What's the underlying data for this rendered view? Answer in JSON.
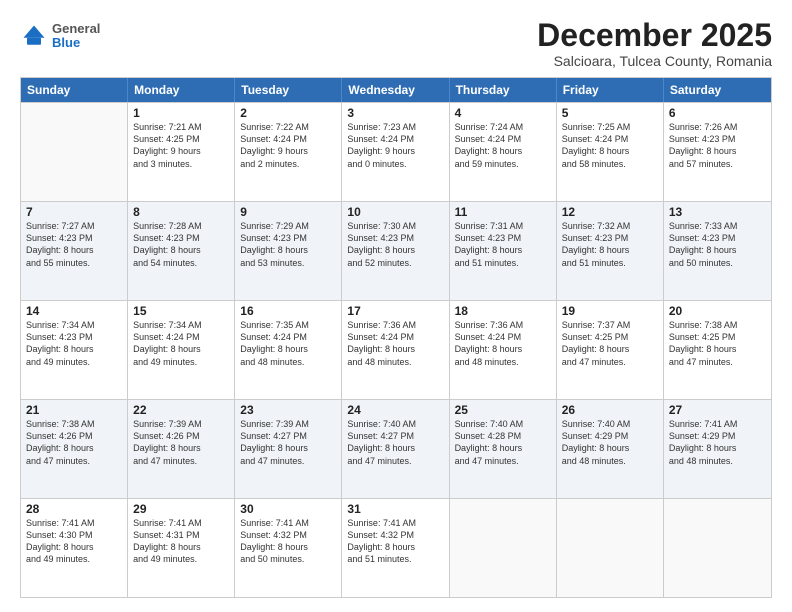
{
  "header": {
    "logo": {
      "general": "General",
      "blue": "Blue"
    },
    "title": "December 2025",
    "subtitle": "Salcioara, Tulcea County, Romania"
  },
  "calendar": {
    "days_of_week": [
      "Sunday",
      "Monday",
      "Tuesday",
      "Wednesday",
      "Thursday",
      "Friday",
      "Saturday"
    ],
    "rows": [
      [
        {
          "day": "",
          "info": ""
        },
        {
          "day": "1",
          "info": "Sunrise: 7:21 AM\nSunset: 4:25 PM\nDaylight: 9 hours\nand 3 minutes."
        },
        {
          "day": "2",
          "info": "Sunrise: 7:22 AM\nSunset: 4:24 PM\nDaylight: 9 hours\nand 2 minutes."
        },
        {
          "day": "3",
          "info": "Sunrise: 7:23 AM\nSunset: 4:24 PM\nDaylight: 9 hours\nand 0 minutes."
        },
        {
          "day": "4",
          "info": "Sunrise: 7:24 AM\nSunset: 4:24 PM\nDaylight: 8 hours\nand 59 minutes."
        },
        {
          "day": "5",
          "info": "Sunrise: 7:25 AM\nSunset: 4:24 PM\nDaylight: 8 hours\nand 58 minutes."
        },
        {
          "day": "6",
          "info": "Sunrise: 7:26 AM\nSunset: 4:23 PM\nDaylight: 8 hours\nand 57 minutes."
        }
      ],
      [
        {
          "day": "7",
          "info": "Sunrise: 7:27 AM\nSunset: 4:23 PM\nDaylight: 8 hours\nand 55 minutes."
        },
        {
          "day": "8",
          "info": "Sunrise: 7:28 AM\nSunset: 4:23 PM\nDaylight: 8 hours\nand 54 minutes."
        },
        {
          "day": "9",
          "info": "Sunrise: 7:29 AM\nSunset: 4:23 PM\nDaylight: 8 hours\nand 53 minutes."
        },
        {
          "day": "10",
          "info": "Sunrise: 7:30 AM\nSunset: 4:23 PM\nDaylight: 8 hours\nand 52 minutes."
        },
        {
          "day": "11",
          "info": "Sunrise: 7:31 AM\nSunset: 4:23 PM\nDaylight: 8 hours\nand 51 minutes."
        },
        {
          "day": "12",
          "info": "Sunrise: 7:32 AM\nSunset: 4:23 PM\nDaylight: 8 hours\nand 51 minutes."
        },
        {
          "day": "13",
          "info": "Sunrise: 7:33 AM\nSunset: 4:23 PM\nDaylight: 8 hours\nand 50 minutes."
        }
      ],
      [
        {
          "day": "14",
          "info": "Sunrise: 7:34 AM\nSunset: 4:23 PM\nDaylight: 8 hours\nand 49 minutes."
        },
        {
          "day": "15",
          "info": "Sunrise: 7:34 AM\nSunset: 4:24 PM\nDaylight: 8 hours\nand 49 minutes."
        },
        {
          "day": "16",
          "info": "Sunrise: 7:35 AM\nSunset: 4:24 PM\nDaylight: 8 hours\nand 48 minutes."
        },
        {
          "day": "17",
          "info": "Sunrise: 7:36 AM\nSunset: 4:24 PM\nDaylight: 8 hours\nand 48 minutes."
        },
        {
          "day": "18",
          "info": "Sunrise: 7:36 AM\nSunset: 4:24 PM\nDaylight: 8 hours\nand 48 minutes."
        },
        {
          "day": "19",
          "info": "Sunrise: 7:37 AM\nSunset: 4:25 PM\nDaylight: 8 hours\nand 47 minutes."
        },
        {
          "day": "20",
          "info": "Sunrise: 7:38 AM\nSunset: 4:25 PM\nDaylight: 8 hours\nand 47 minutes."
        }
      ],
      [
        {
          "day": "21",
          "info": "Sunrise: 7:38 AM\nSunset: 4:26 PM\nDaylight: 8 hours\nand 47 minutes."
        },
        {
          "day": "22",
          "info": "Sunrise: 7:39 AM\nSunset: 4:26 PM\nDaylight: 8 hours\nand 47 minutes."
        },
        {
          "day": "23",
          "info": "Sunrise: 7:39 AM\nSunset: 4:27 PM\nDaylight: 8 hours\nand 47 minutes."
        },
        {
          "day": "24",
          "info": "Sunrise: 7:40 AM\nSunset: 4:27 PM\nDaylight: 8 hours\nand 47 minutes."
        },
        {
          "day": "25",
          "info": "Sunrise: 7:40 AM\nSunset: 4:28 PM\nDaylight: 8 hours\nand 47 minutes."
        },
        {
          "day": "26",
          "info": "Sunrise: 7:40 AM\nSunset: 4:29 PM\nDaylight: 8 hours\nand 48 minutes."
        },
        {
          "day": "27",
          "info": "Sunrise: 7:41 AM\nSunset: 4:29 PM\nDaylight: 8 hours\nand 48 minutes."
        }
      ],
      [
        {
          "day": "28",
          "info": "Sunrise: 7:41 AM\nSunset: 4:30 PM\nDaylight: 8 hours\nand 49 minutes."
        },
        {
          "day": "29",
          "info": "Sunrise: 7:41 AM\nSunset: 4:31 PM\nDaylight: 8 hours\nand 49 minutes."
        },
        {
          "day": "30",
          "info": "Sunrise: 7:41 AM\nSunset: 4:32 PM\nDaylight: 8 hours\nand 50 minutes."
        },
        {
          "day": "31",
          "info": "Sunrise: 7:41 AM\nSunset: 4:32 PM\nDaylight: 8 hours\nand 51 minutes."
        },
        {
          "day": "",
          "info": ""
        },
        {
          "day": "",
          "info": ""
        },
        {
          "day": "",
          "info": ""
        }
      ]
    ]
  }
}
